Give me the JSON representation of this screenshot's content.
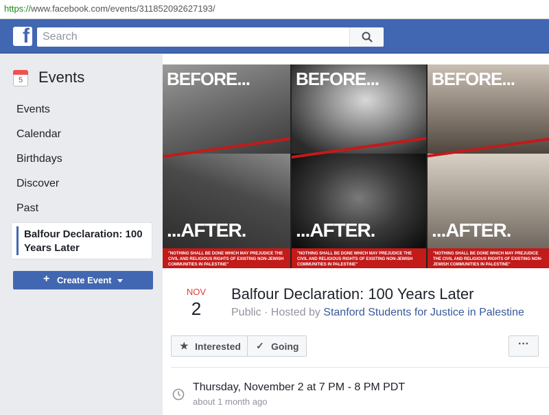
{
  "browser": {
    "url_protocol": "https://",
    "url_rest": "www.facebook.com/events/311852092627193/"
  },
  "topbar": {
    "search_placeholder": "Search"
  },
  "sidebar": {
    "title": "Events",
    "calendar_day": "5",
    "items": [
      {
        "label": "Events"
      },
      {
        "label": "Calendar"
      },
      {
        "label": "Birthdays"
      },
      {
        "label": "Discover"
      },
      {
        "label": "Past"
      }
    ],
    "active_item": "Balfour Declaration: 100 Years Later",
    "create_label": "Create Event"
  },
  "cover": {
    "before_text": "BEFORE...",
    "after_text": "...AFTER.",
    "quote": "\"NOTHING SHALL BE DONE WHICH MAY PREJUDICE THE CIVIL AND RELIGIOUS RIGHTS OF EXISTING NON-JEWISH COMMUNITIES IN PALESTINE\""
  },
  "event": {
    "month": "NOV",
    "day": "2",
    "title": "Balfour Declaration: 100 Years Later",
    "privacy": "Public · Hosted by ",
    "host": "Stanford Students for Justice in Palestine",
    "interested_label": "Interested",
    "going_label": "Going",
    "more_label": "···",
    "time": "Thursday, November 2 at 7 PM - 8 PM PDT",
    "time_relative": "about 1 month ago"
  },
  "colors": {
    "brand": "#4267b2",
    "accent_red": "#c31a1a",
    "link": "#365899"
  }
}
